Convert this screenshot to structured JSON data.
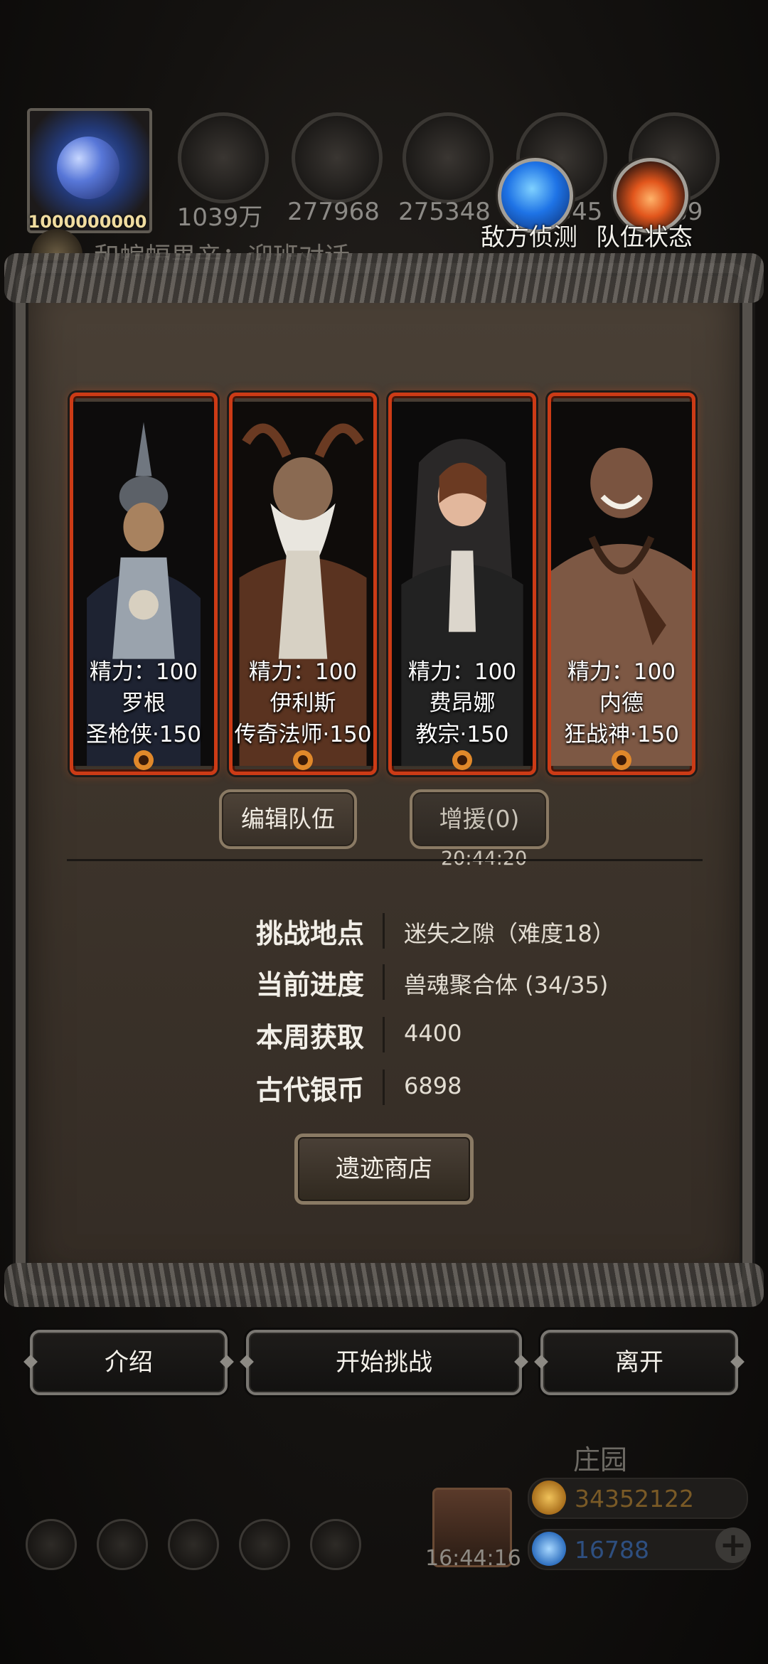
{
  "hud": {
    "avatar_value": "1000000000",
    "resources": [
      {
        "value": "1039万",
        "icon": "carrot-icon"
      },
      {
        "value": "277968",
        "icon": "wood-icon"
      },
      {
        "value": "275348",
        "icon": "iron-icon"
      },
      {
        "value": "345",
        "icon": "feather-icon"
      },
      {
        "value": "189",
        "icon": "coal-icon"
      }
    ],
    "chat_preview": "和蝙蝠男亲：迎班对话",
    "scout_label": "敌方侦测",
    "team_status_label": "队伍状态"
  },
  "team": {
    "heroes": [
      {
        "energy": "精力：100",
        "name": "罗根",
        "class_level": "圣枪侠·150"
      },
      {
        "energy": "精力：100",
        "name": "伊利斯",
        "class_level": "传奇法师·150"
      },
      {
        "energy": "精力：100",
        "name": "费昂娜",
        "class_level": "教宗·150"
      },
      {
        "energy": "精力：100",
        "name": "内德",
        "class_level": "狂战神·150"
      }
    ],
    "edit_label": "编辑队伍",
    "reinforce_label": "增援(0)",
    "timer": "20:44:20"
  },
  "info": {
    "location_label": "挑战地点",
    "location_value": "迷失之隙（难度18）",
    "progress_label": "当前进度",
    "progress_value": "兽魂聚合体 (34/35)",
    "weekly_label": "本周获取",
    "weekly_value": "4400",
    "coins_label": "古代银币",
    "coins_value": "6898",
    "shop_label": "遗迹商店"
  },
  "actions": {
    "intro_label": "介绍",
    "start_label": "开始挑战",
    "leave_label": "离开"
  },
  "bottom": {
    "time": "16:44:16",
    "manor_label": "庄园",
    "gold": "34352122",
    "gems": "16788",
    "plus": "+"
  },
  "colors": {
    "card_border": "#cc3b16",
    "gold_text": "#e0a63a",
    "gem_text": "#4a7fd0"
  }
}
